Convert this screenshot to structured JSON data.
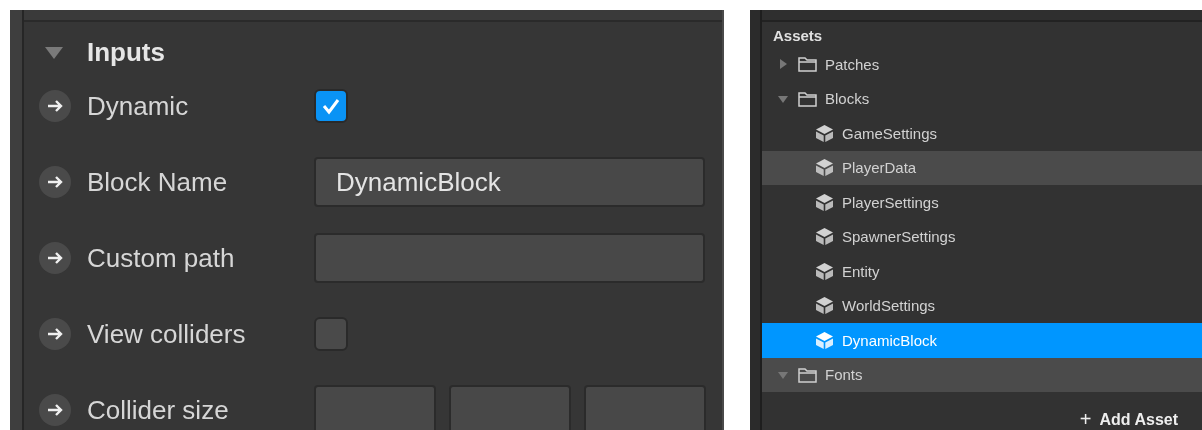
{
  "inspector": {
    "section": {
      "title": "Inputs",
      "expanded": true
    },
    "rows": [
      {
        "kind": "checkbox",
        "label": "Dynamic",
        "checked": true
      },
      {
        "kind": "text",
        "label": "Block Name",
        "value": "DynamicBlock"
      },
      {
        "kind": "text",
        "label": "Custom path"
      },
      {
        "kind": "checkbox",
        "label": "View colliders",
        "checked": false
      },
      {
        "kind": "vector",
        "label": "Collider size"
      }
    ]
  },
  "assets": {
    "title": "Assets",
    "tree": [
      {
        "kind": "folder",
        "label": "Patches",
        "expanded": false,
        "selected": false,
        "highlighted": false
      },
      {
        "kind": "folder",
        "label": "Blocks",
        "expanded": true,
        "selected": false,
        "highlighted": false,
        "children": [
          {
            "kind": "block",
            "label": "GameSettings",
            "selected": false,
            "highlighted": false
          },
          {
            "kind": "block",
            "label": "PlayerData",
            "selected": false,
            "highlighted": true
          },
          {
            "kind": "block",
            "label": "PlayerSettings",
            "selected": false,
            "highlighted": false
          },
          {
            "kind": "block",
            "label": "SpawnerSettings",
            "selected": false,
            "highlighted": false
          },
          {
            "kind": "block",
            "label": "Entity",
            "selected": false,
            "highlighted": false
          },
          {
            "kind": "block",
            "label": "WorldSettings",
            "selected": false,
            "highlighted": false
          },
          {
            "kind": "block",
            "label": "DynamicBlock",
            "selected": true,
            "highlighted": false
          }
        ]
      },
      {
        "kind": "folder",
        "label": "Fonts",
        "expanded": true,
        "selected": false,
        "highlighted": true
      }
    ],
    "add_button": {
      "icon": "+",
      "label": "Add Asset"
    }
  }
}
